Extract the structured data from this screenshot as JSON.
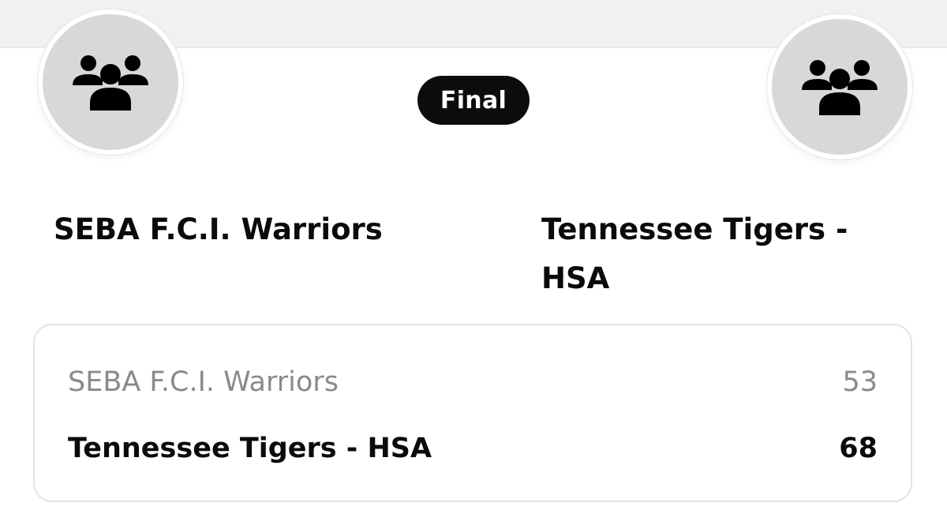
{
  "game": {
    "status": "Final",
    "home_team": {
      "name": "SEBA F.C.I. Warriors",
      "logo_icon": "team-group-icon"
    },
    "away_team": {
      "name": "Tennessee Tigers - HSA",
      "logo_icon": "team-group-icon"
    }
  },
  "scoreboard": {
    "rows": [
      {
        "team": "SEBA F.C.I. Warriors",
        "score": "53",
        "winner": false
      },
      {
        "team": "Tennessee Tigers - HSA",
        "score": "68",
        "winner": true
      }
    ]
  },
  "colors": {
    "status_pill_bg": "#0c0c0c",
    "logo_bg": "#d8d8d8",
    "loser_text": "#8a8a8a",
    "winner_text": "#0b0b0b"
  }
}
